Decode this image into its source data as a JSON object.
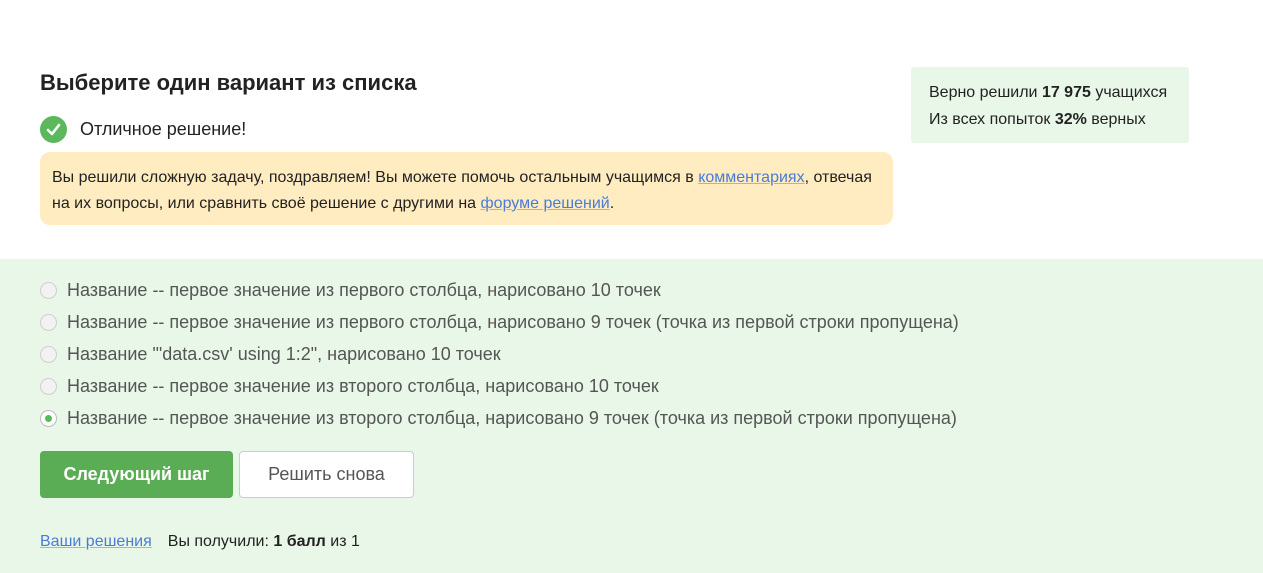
{
  "quiz": {
    "title": "Выберите один вариант из списка",
    "status": "Отличное решение!"
  },
  "notice": {
    "text_1": "Вы решили сложную задачу, поздравляем! Вы можете помочь остальным учащимся в ",
    "link_comments": "комментариях",
    "text_2": ", отвечая на их вопросы, или сравнить своё решение с другими на ",
    "link_forum": "форуме решений",
    "text_3": "."
  },
  "stats": {
    "solved_prefix": "Верно решили ",
    "solved_count": "17 975",
    "solved_suffix": " учащихся",
    "attempts_prefix": "Из всех попыток ",
    "attempts_percent": "32%",
    "attempts_suffix": " верных"
  },
  "options": [
    {
      "label": "Название -- первое значение из первого столбца, нарисовано 10 точек",
      "selected": false
    },
    {
      "label": "Название -- первое значение из первого столбца, нарисовано 9 точек (точка из первой строки пропущена)",
      "selected": false
    },
    {
      "label": "Название \"'data.csv' using 1:2\", нарисовано 10 точек",
      "selected": false
    },
    {
      "label": "Название -- первое значение из второго столбца, нарисовано 10 точек",
      "selected": false
    },
    {
      "label": "Название -- первое значение из второго столбца, нарисовано 9 точек (точка из первой строки пропущена)",
      "selected": true
    }
  ],
  "buttons": {
    "next": "Следующий шаг",
    "retry": "Решить снова"
  },
  "footer": {
    "solutions_link": "Ваши решения",
    "score_prefix": "Вы получили: ",
    "score_value": "1 балл",
    "score_mid": " из ",
    "score_max": "1"
  },
  "colors": {
    "accent_green": "#5aad55",
    "panel_green": "#e9f7e8",
    "notice_yellow": "#ffecc0",
    "link_blue": "#4a7bd6"
  }
}
